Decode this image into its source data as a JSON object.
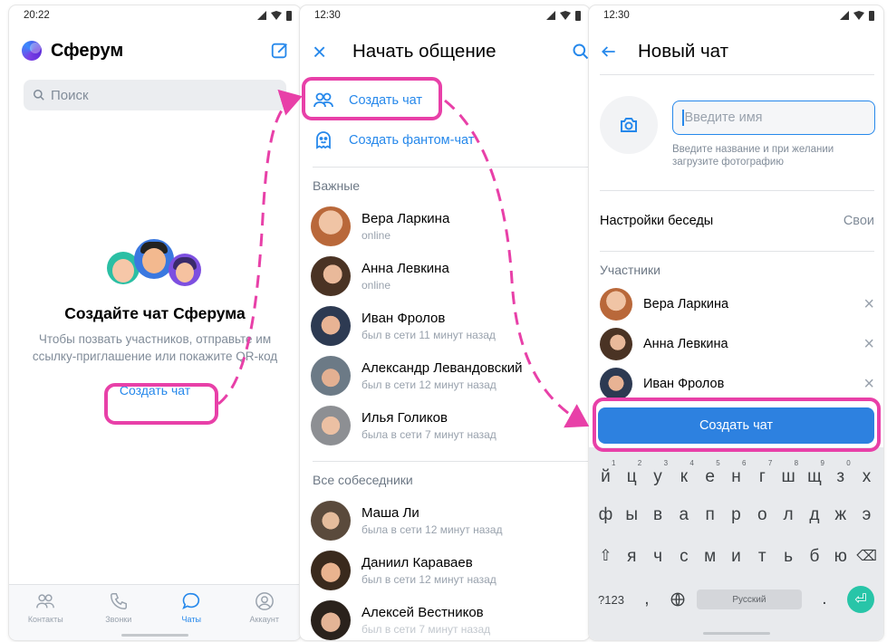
{
  "colors": {
    "accent": "#2688EB",
    "highlight": "#E840A8",
    "button": "#2D81E0"
  },
  "panel1": {
    "status_time": "20:22",
    "app_title": "Сферум",
    "search_placeholder": "Поиск",
    "empty_title": "Создайте чат Сферума",
    "empty_desc": "Чтобы позвать участников, отправьте им ссылку-приглашение или покажите QR-код",
    "create_link": "Создать чат",
    "tabs": [
      {
        "label": "Контакты",
        "icon": "contacts-icon"
      },
      {
        "label": "Звонки",
        "icon": "phone-icon"
      },
      {
        "label": "Чаты",
        "icon": "chat-bubble-icon",
        "active": true
      },
      {
        "label": "Аккаунт",
        "icon": "account-icon"
      }
    ]
  },
  "panel2": {
    "status_time": "12:30",
    "title": "Начать общение",
    "actions": [
      {
        "label": "Создать чат",
        "icon": "people-icon"
      },
      {
        "label": "Создать фантом-чат",
        "icon": "ghost-icon"
      }
    ],
    "important_label": "Важные",
    "important": [
      {
        "name": "Вера Ларкина",
        "status": "online"
      },
      {
        "name": "Анна Левкина",
        "status": "online"
      },
      {
        "name": "Иван Фролов",
        "status": "был в сети 11 минут назад"
      },
      {
        "name": "Александр Левандовский",
        "status": "был в сети 12 минут назад"
      },
      {
        "name": "Илья Голиков",
        "status": "была в сети 7 минут назад"
      }
    ],
    "all_label": "Все собеседники",
    "all": [
      {
        "name": "Маша Ли",
        "status": "была в сети 12 минут назад"
      },
      {
        "name": "Даниил Караваев",
        "status": "был в сети 12 минут назад"
      },
      {
        "name": "Алексей Вестников",
        "status": "был в сети 7 минут назад"
      }
    ]
  },
  "panel3": {
    "status_time": "12:30",
    "title": "Новый чат",
    "name_placeholder": "Введите имя",
    "hint": "Введите название и при желании загрузите фотографию",
    "settings_label": "Настройки беседы",
    "settings_value": "Свои",
    "members_label": "Участники",
    "members": [
      {
        "name": "Вера Ларкина"
      },
      {
        "name": "Анна Левкина"
      },
      {
        "name": "Иван Фролов"
      }
    ],
    "create_button": "Создать чат",
    "keyboard": {
      "row1": [
        "й",
        "ц",
        "у",
        "к",
        "е",
        "н",
        "г",
        "ш",
        "щ",
        "з",
        "х"
      ],
      "row1_digits": [
        "1",
        "2",
        "3",
        "4",
        "5",
        "6",
        "7",
        "8",
        "9",
        "0",
        ""
      ],
      "row2": [
        "ф",
        "ы",
        "в",
        "а",
        "п",
        "р",
        "о",
        "л",
        "д",
        "ж",
        "э"
      ],
      "row3": [
        "я",
        "ч",
        "с",
        "м",
        "и",
        "т",
        "ь",
        "б",
        "ю"
      ],
      "symbols_key": "?123",
      "comma_key": ",",
      "space_label": "Русский",
      "period_key": "."
    }
  }
}
